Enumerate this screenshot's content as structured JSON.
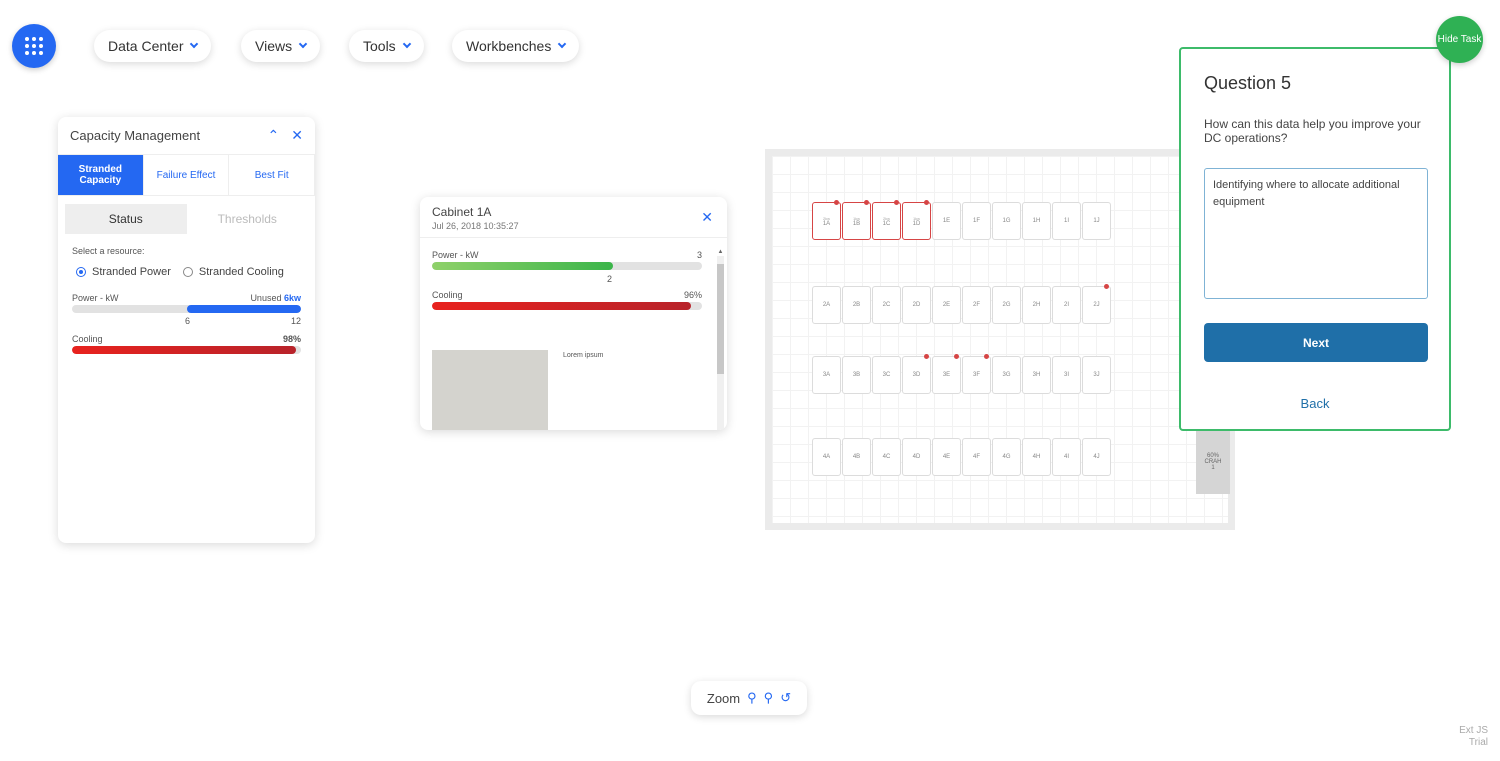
{
  "nav": {
    "items": [
      {
        "label": "Data Center"
      },
      {
        "label": "Views"
      },
      {
        "label": "Tools"
      },
      {
        "label": "Workbenches"
      }
    ]
  },
  "capacity": {
    "title": "Capacity Management",
    "tabs": [
      "Stranded Capacity",
      "Failure Effect",
      "Best Fit"
    ],
    "active_tab": "Stranded Capacity",
    "subtabs": [
      "Status",
      "Thresholds"
    ],
    "active_subtab": "Status",
    "select_label": "Select a resource:",
    "resources": [
      "Stranded Power",
      "Stranded Cooling"
    ],
    "selected_resource": "Stranded Power",
    "power": {
      "label": "Power - kW",
      "unused_label": "Unused",
      "unused_value": "6kw",
      "min_label": "6",
      "max_label": "12",
      "used_fraction": 0.5
    },
    "cooling": {
      "label": "Cooling",
      "value": "98%",
      "fraction": 0.98
    }
  },
  "cabinet": {
    "title": "Cabinet 1A",
    "date": "Jul 26, 2018 10:35:27",
    "power": {
      "label": "Power - kW",
      "max": "3",
      "current": "2",
      "fraction": 0.67
    },
    "cooling": {
      "label": "Cooling",
      "value": "96%",
      "fraction": 0.96
    },
    "lorem": "Lorem ipsum"
  },
  "floor": {
    "rows": [
      [
        "1A",
        "1B",
        "1C",
        "1D",
        "1E",
        "1F",
        "1G",
        "1H",
        "1I",
        "1J"
      ],
      [
        "2A",
        "2B",
        "2C",
        "2D",
        "2E",
        "2F",
        "2G",
        "2H",
        "2I",
        "2J"
      ],
      [
        "3A",
        "3B",
        "3C",
        "3D",
        "3E",
        "3F",
        "3G",
        "3H",
        "3I",
        "3J"
      ],
      [
        "4A",
        "4B",
        "4C",
        "4D",
        "4E",
        "4F",
        "4G",
        "4H",
        "4I",
        "4J"
      ]
    ],
    "selected": [
      "1A",
      "1B",
      "1C",
      "1D"
    ],
    "prefix_labels": {
      "1A": "2kw",
      "1B": "1kw",
      "1C": "2kw",
      "1D": "1kw"
    },
    "alerts": [
      "1A",
      "1B",
      "1C",
      "1D",
      "2J",
      "3D",
      "3E",
      "3F"
    ],
    "crah_label": "CRAH",
    "crah_top": "60%",
    "crah_bottom": "1"
  },
  "question": {
    "title": "Question 5",
    "text": "How can this data help you improve your DC operations?",
    "answer": "Identifying where to allocate additional equipment",
    "next_label": "Next",
    "back_label": "Back",
    "hide_label": "Hide Task"
  },
  "zoom": {
    "label": "Zoom"
  },
  "watermark": {
    "line1": "Ext JS",
    "line2": "Trial"
  },
  "colors": {
    "accent": "#2468f2",
    "green": "#3dbb6a",
    "red": "#d62a2a",
    "next_btn": "#1f6fa8"
  }
}
